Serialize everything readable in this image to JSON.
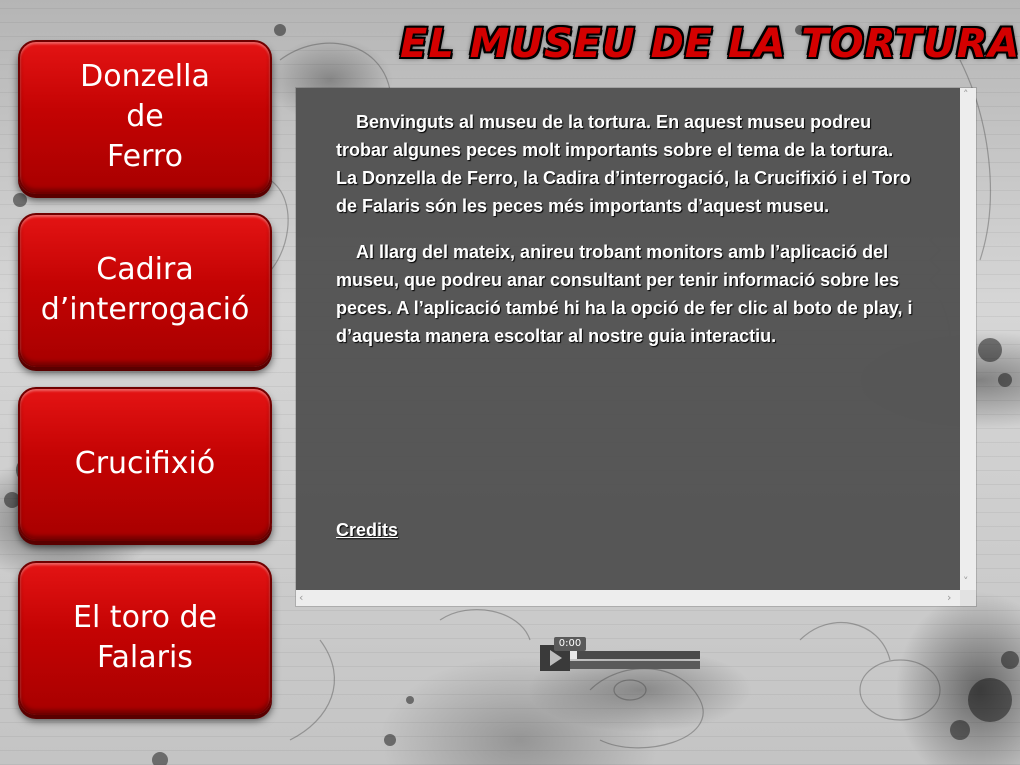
{
  "title": "EL MUSEU DE LA TORTURA",
  "nav": [
    {
      "label": "Donzella\nde\nFerro"
    },
    {
      "label": "Cadira\nd’interrogació"
    },
    {
      "label": "Crucifixió"
    },
    {
      "label": "El toro de\nFalaris"
    }
  ],
  "content": {
    "paragraphs": [
      "Benvinguts al museu de la tortura. En aquest museu podreu trobar algunes peces molt importants sobre el tema de la tortura. La Donzella de Ferro, la Cadira d’interrogació, la Crucifixió i el Toro de Falaris són les peces més importants d’aquest museu.",
      "Al llarg del mateix, anireu trobant monitors amb l’aplicació del museu, que podreu anar consultant per tenir informació sobre les peces. A l’aplicació també hi ha la opció de fer clic al boto de play, i d’aquesta manera escoltar al nostre guia interactiu."
    ],
    "credits_label": "Credits"
  },
  "player": {
    "time": "0:00",
    "progress_fraction": 0.05
  },
  "colors": {
    "button_red": "#c40303",
    "title_red": "#d40000",
    "panel_dark": "#464646"
  },
  "icons": {
    "play": "play-icon",
    "scroll_up": "chevron-up-icon",
    "scroll_down": "chevron-down-icon",
    "scroll_left": "chevron-left-icon",
    "scroll_right": "chevron-right-icon"
  }
}
